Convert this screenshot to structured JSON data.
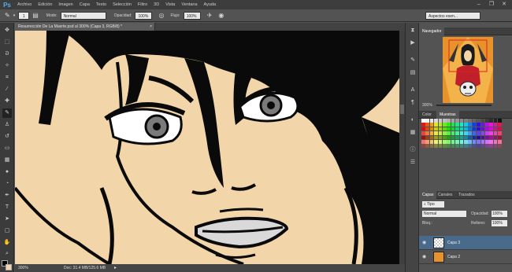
{
  "app": {
    "logo": "Ps"
  },
  "menubar": {
    "items": [
      "Archivo",
      "Edición",
      "Imagen",
      "Capa",
      "Texto",
      "Selección",
      "Filtro",
      "3D",
      "Vista",
      "Ventana",
      "Ayuda"
    ],
    "window_controls": {
      "minimize": "–",
      "restore": "❐",
      "close": "✕"
    }
  },
  "options_bar": {
    "brush_size": "1",
    "mode_label": "Modo:",
    "mode_value": "Normal",
    "opacity_label": "Opacidad:",
    "opacity_value": "100%",
    "flow_label": "Flujo:",
    "flow_value": "100%",
    "workspace": "Aspectos esen..."
  },
  "document": {
    "tab_title": "Resurrección De La Muerte.psd al 300% (Capa 3, RGB/8) *",
    "tab_close": "×",
    "zoom": "300%",
    "doc_info": "Doc: 31.4 MB/125.6 MB"
  },
  "navigator": {
    "title": "Navegador",
    "zoom": "300%"
  },
  "color_panel": {
    "tabs": [
      "Color",
      "Muestras"
    ],
    "active_tab": "Muestras"
  },
  "layers_panel": {
    "tabs": [
      "Capas",
      "Canales",
      "Trazados"
    ],
    "active_tab": "Capas",
    "filter_kind": "Tipo",
    "blend_mode": "Normal",
    "opacity_label": "Opacidad:",
    "opacity_value": "100%",
    "lock_label": "Bloq.:",
    "fill_label": "Relleno:",
    "fill_value": "100%",
    "layers": [
      {
        "name": "Capa 3",
        "selected": true
      },
      {
        "name": "Capa 2",
        "selected": false
      }
    ]
  },
  "colors": {
    "skin": "#f2d5a8",
    "hair": "#0a0a0a",
    "selection": "#4a6a8c",
    "accent": "#4fb0f0"
  }
}
